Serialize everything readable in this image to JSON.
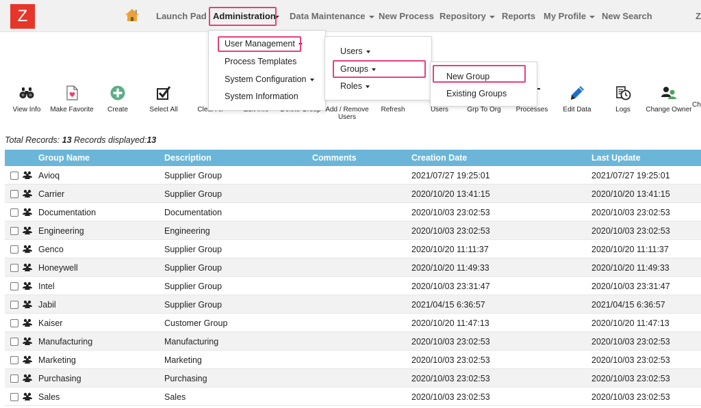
{
  "logo": {
    "letter": "Z"
  },
  "nav": {
    "items": [
      {
        "label": "Launch Pad",
        "caret": false
      },
      {
        "label": "Administration",
        "caret": true
      },
      {
        "label": "Data Maintenance",
        "caret": true
      },
      {
        "label": "New Process",
        "caret": false
      },
      {
        "label": "Repository",
        "caret": true
      },
      {
        "label": "Reports",
        "caret": false
      },
      {
        "label": "My Profile",
        "caret": true
      },
      {
        "label": "New Search",
        "caret": false
      },
      {
        "label": "Z",
        "caret": false
      }
    ]
  },
  "admin_menu": {
    "items": [
      "User Management",
      "Process Templates",
      "System Configuration",
      "System Information"
    ]
  },
  "user_mgmt_menu": {
    "items": [
      "Users",
      "Groups",
      "Roles"
    ]
  },
  "groups_menu": {
    "items": [
      "New Group",
      "Existing Groups"
    ]
  },
  "toolbar": {
    "items": [
      {
        "label": "View Info",
        "icon": "binoculars-icon"
      },
      {
        "label": "Make Favorite",
        "icon": "favorite-heart-icon"
      },
      {
        "label": "Create",
        "icon": "plus-circle-icon"
      },
      {
        "label": "Select All",
        "icon": "checkbox-check-icon"
      },
      {
        "label": "Clear All",
        "icon": "clear-icon"
      },
      {
        "label": "Edit Info",
        "icon": "edit-info-icon"
      },
      {
        "label": "Delete Group",
        "icon": "delete-icon"
      },
      {
        "label": "Add / Remove",
        "label2": "Users",
        "icon": "add-remove-users-icon"
      },
      {
        "label": "Refresh",
        "icon": "refresh-icon"
      },
      {
        "label": "Users",
        "icon": "users-icon"
      },
      {
        "label": "Grp To Org",
        "icon": "group-to-org-icon"
      },
      {
        "label": "Processes",
        "icon": "processes-icon"
      },
      {
        "label": "Edit Data",
        "icon": "pen-icon"
      },
      {
        "label": "Logs",
        "icon": "logs-clock-icon"
      },
      {
        "label": "Change Owner",
        "icon": "change-owner-icon"
      },
      {
        "label": "Ch",
        "icon": ""
      }
    ]
  },
  "records": {
    "total_label": "Total Records:",
    "total": "13",
    "displayed_label": "Records displayed:",
    "displayed": "13"
  },
  "table": {
    "headers": [
      "Group Name",
      "Description",
      "Comments",
      "Creation Date",
      "Last Update"
    ],
    "rows": [
      [
        "Avioq",
        "Supplier Group",
        "",
        "2021/07/27 19:25:01",
        "2021/07/27 19:25:01"
      ],
      [
        "Carrier",
        "Supplier Group",
        "",
        "2020/10/20 13:41:15",
        "2020/10/20 13:41:15"
      ],
      [
        "Documentation",
        "Documentation",
        "",
        "2020/10/03 23:02:53",
        "2020/10/03 23:02:53"
      ],
      [
        "Engineering",
        "Engineering",
        "",
        "2020/10/03 23:02:53",
        "2020/10/03 23:02:53"
      ],
      [
        "Genco",
        "Supplier Group",
        "",
        "2020/10/20 11:11:37",
        "2020/10/20 11:11:37"
      ],
      [
        "Honeywell",
        "Supplier Group",
        "",
        "2020/10/20 11:49:33",
        "2020/10/20 11:49:33"
      ],
      [
        "Intel",
        "Supplier Group",
        "",
        "2020/10/03 23:31:47",
        "2020/10/03 23:31:47"
      ],
      [
        "Jabil",
        "Supplier Group",
        "",
        "2021/04/15 6:36:57",
        "2021/04/15 6:36:57"
      ],
      [
        "Kaiser",
        "Customer Group",
        "",
        "2020/10/20 11:47:13",
        "2020/10/20 11:47:13"
      ],
      [
        "Manufacturing",
        "Manufacturing",
        "",
        "2020/10/03 23:02:53",
        "2020/10/03 23:02:53"
      ],
      [
        "Marketing",
        "Marketing",
        "",
        "2020/10/03 23:02:53",
        "2020/10/03 23:02:53"
      ],
      [
        "Purchasing",
        "Purchasing",
        "",
        "2020/10/03 23:02:53",
        "2020/10/03 23:02:53"
      ],
      [
        "Sales",
        "Sales",
        "",
        "2020/10/03 23:02:53",
        "2020/10/03 23:02:53"
      ]
    ]
  },
  "colors": {
    "brand": "#e8352a",
    "header": "#6bb6d8",
    "highlight": "#e6407a"
  }
}
